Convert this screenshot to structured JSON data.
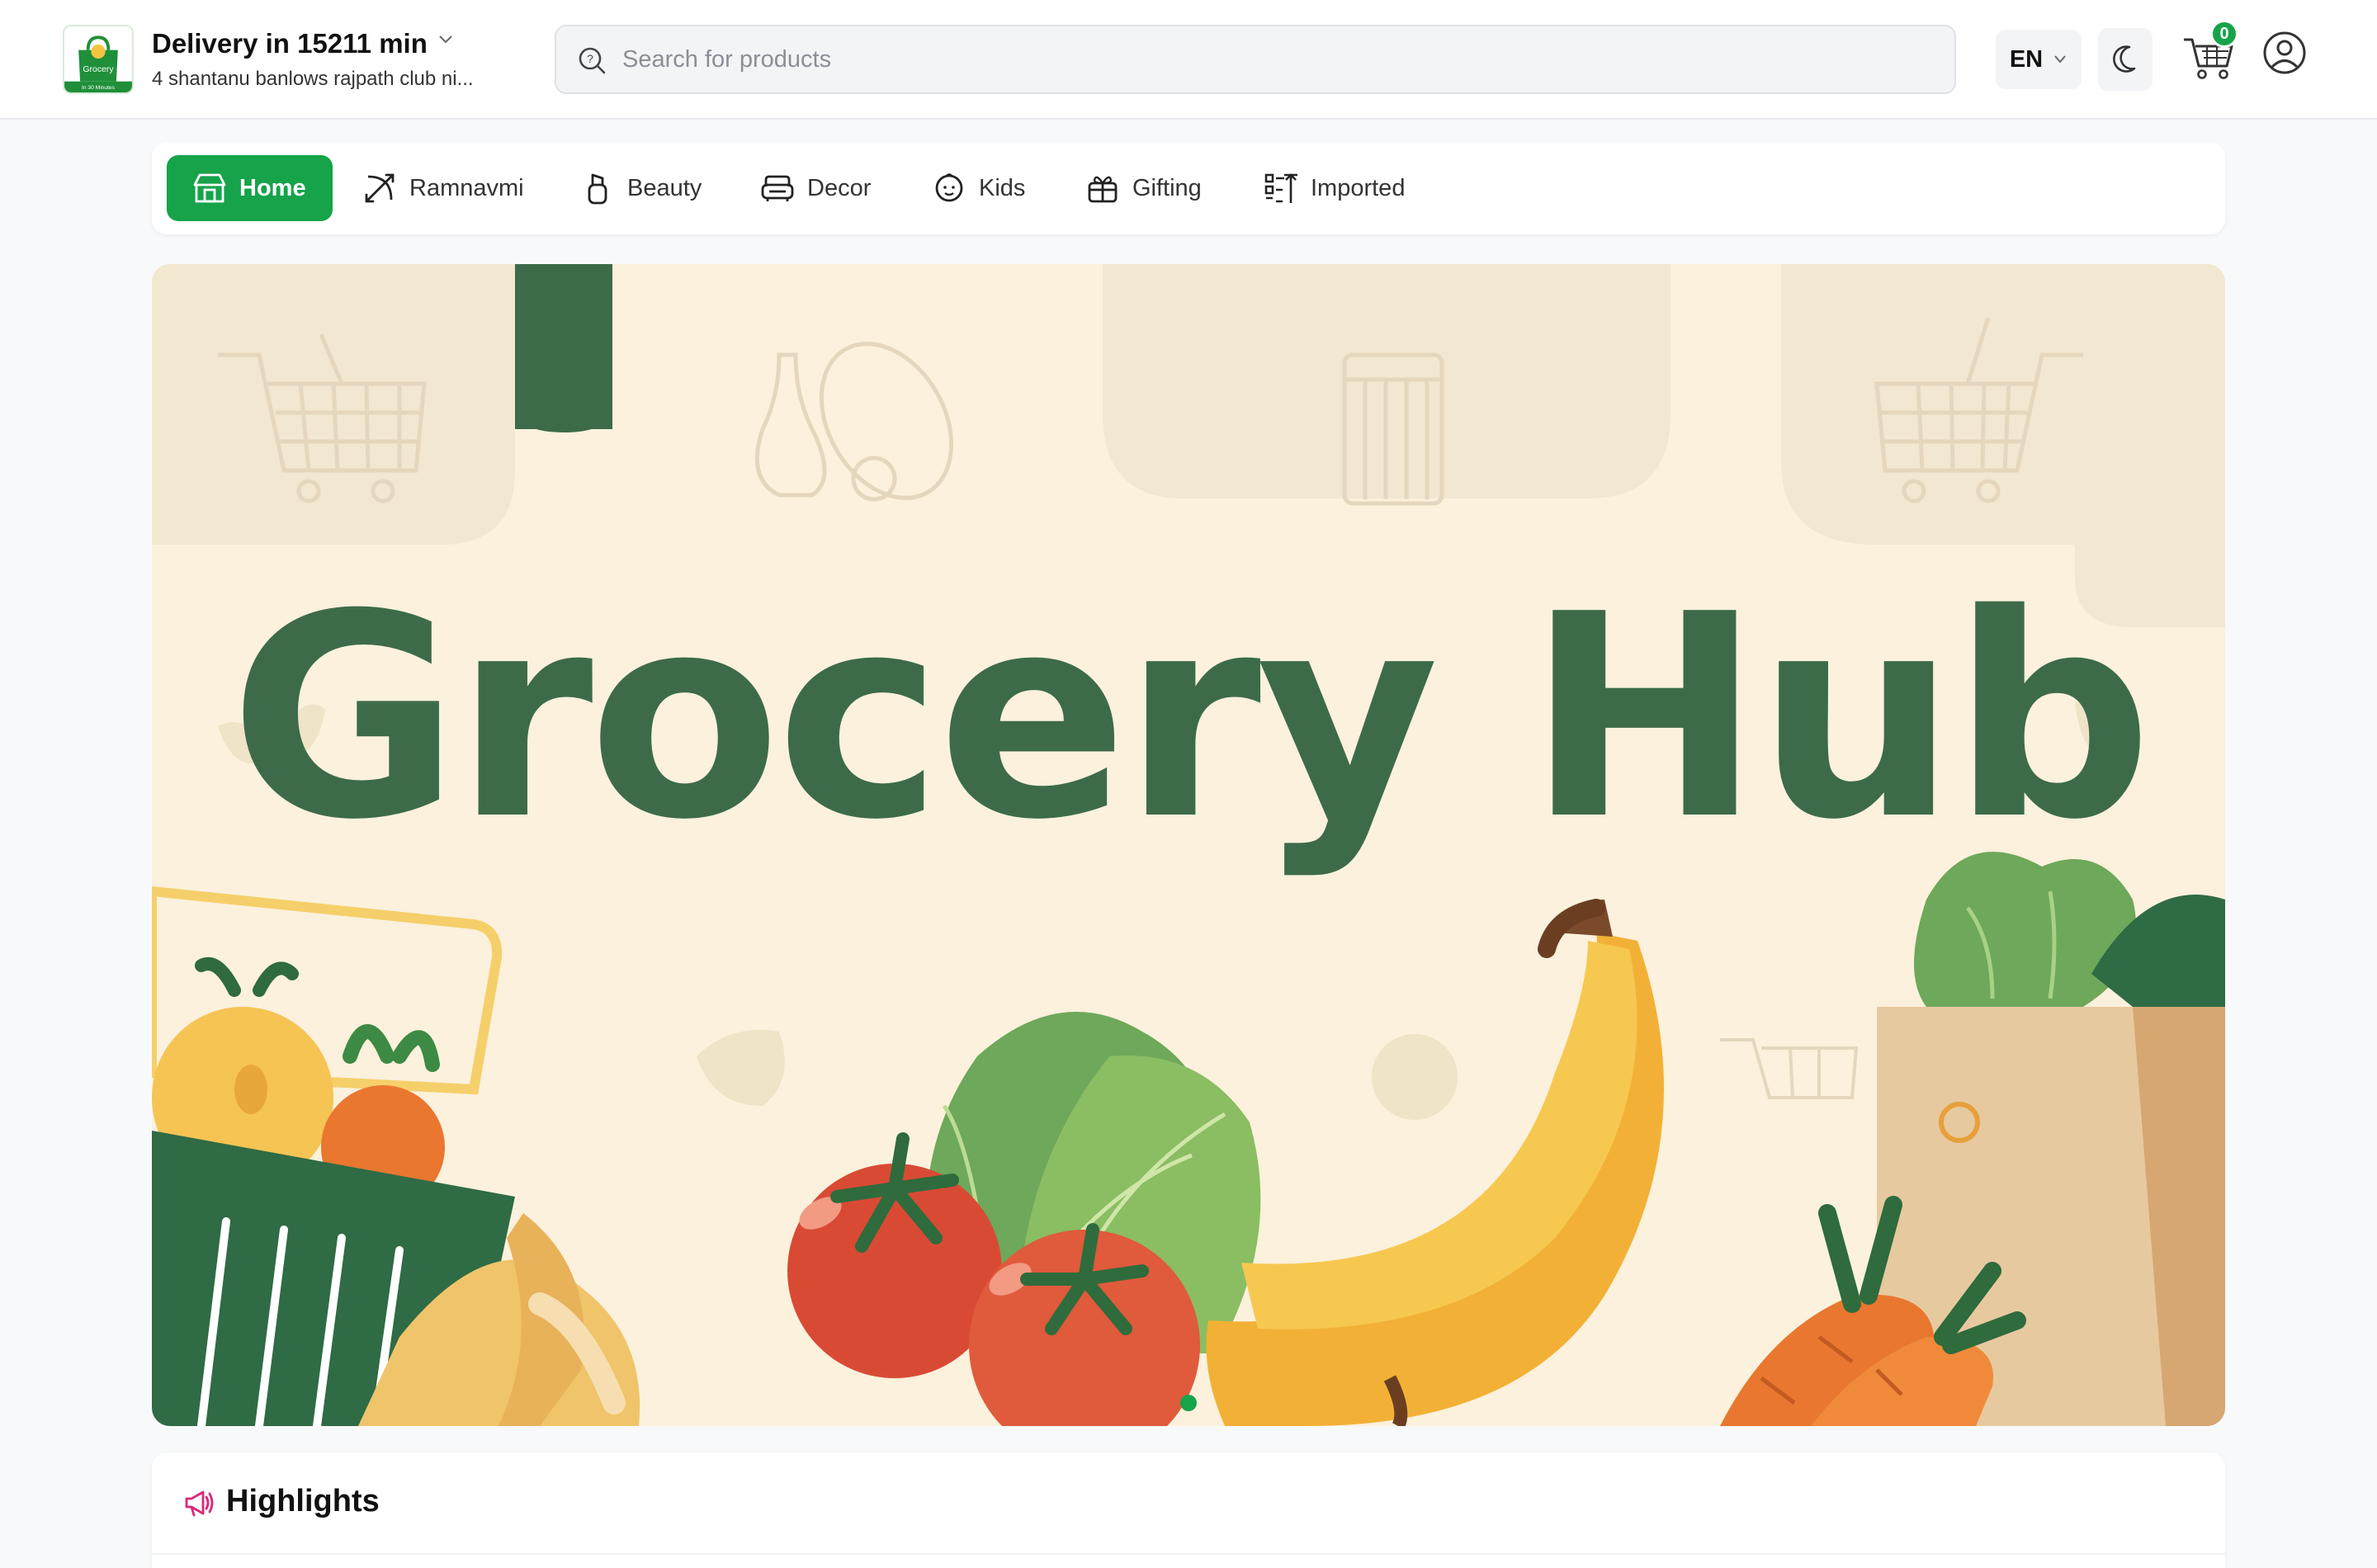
{
  "header": {
    "logo": {
      "icon": "grocery-bag-logo",
      "text": "Grocery",
      "tagline": "In 30 Minutes"
    },
    "delivery_title": "Delivery in 15211 min",
    "delivery_address": "4 shantanu banlows rajpath club ni...",
    "search": {
      "placeholder": "Search for products",
      "value": "",
      "icon": "search-icon"
    },
    "language": "EN",
    "theme_icon": "moon-icon",
    "cart": {
      "icon": "cart-icon",
      "count": "0"
    },
    "profile_icon": "user-icon"
  },
  "categories": [
    {
      "label": "Home",
      "icon": "store-icon",
      "active": true
    },
    {
      "label": "Ramnavmi",
      "icon": "bow-arrow-icon",
      "active": false
    },
    {
      "label": "Beauty",
      "icon": "bottle-icon",
      "active": false
    },
    {
      "label": "Decor",
      "icon": "sofa-icon",
      "active": false
    },
    {
      "label": "Kids",
      "icon": "baby-icon",
      "active": false
    },
    {
      "label": "Gifting",
      "icon": "gift-icon",
      "active": false
    },
    {
      "label": "Imported",
      "icon": "import-list-icon",
      "active": false
    }
  ],
  "banner": {
    "title": "Grocery Hub",
    "slides": 1,
    "active_slide": 1
  },
  "highlights": {
    "title": "Highlights",
    "icon": "megaphone-icon"
  },
  "colors": {
    "accent": "#16a34a",
    "banner_text": "#3d6b4a",
    "banner_bg": "#fbf1dc"
  }
}
